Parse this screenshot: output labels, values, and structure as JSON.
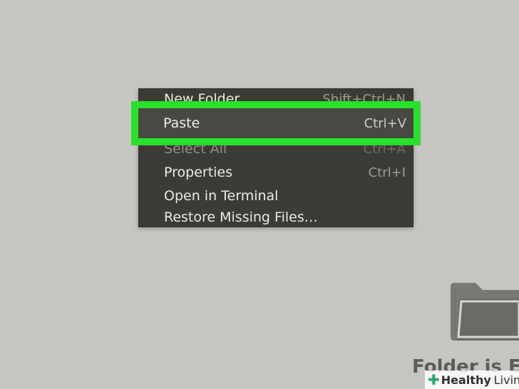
{
  "context_menu": {
    "items": [
      {
        "label": "New Folder",
        "shortcut": "Shift+Ctrl+N",
        "disabled": false
      },
      {
        "label": "Paste",
        "shortcut": "Ctrl+V",
        "disabled": false,
        "highlighted": true
      },
      {
        "label": "Select All",
        "shortcut": "Ctrl+A",
        "disabled": true
      },
      {
        "label": "Properties",
        "shortcut": "Ctrl+I",
        "disabled": false
      },
      {
        "label": "Open in Terminal",
        "shortcut": "",
        "disabled": false
      },
      {
        "label": "Restore Missing Files…",
        "shortcut": "",
        "disabled": false
      }
    ]
  },
  "highlight_color": "#28e12a",
  "folder": {
    "icon": "folder-icon",
    "empty_label": "Folder is Em"
  },
  "watermark": {
    "icon": "plus-cross-icon",
    "text_bold": "Healthy",
    "text_regular": "Living"
  }
}
